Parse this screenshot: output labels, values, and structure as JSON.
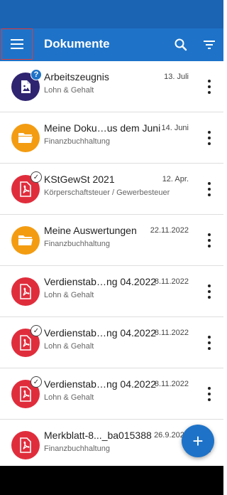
{
  "app": {
    "title": "Dokumente",
    "icons": {
      "menu": "menu-icon",
      "search": "search-icon",
      "filter": "filter-icon",
      "add": "plus-icon"
    },
    "colors": {
      "primary": "#1e73c8",
      "statusbar": "#1b64b3",
      "image_doc": "#2f2470",
      "folder": "#f39c12",
      "pdf": "#e02d3c"
    },
    "fab_label": "+"
  },
  "documents": [
    {
      "title": "Arbeitszeugnis",
      "date": "13. Juli",
      "category": "Lohn & Gehalt",
      "type": "image",
      "badge": "question",
      "badge_text": "?"
    },
    {
      "title": "Meine Doku…us dem Juni",
      "date": "14. Juni",
      "category": "Finanzbuchhaltung",
      "type": "folder",
      "badge": ""
    },
    {
      "title": "KStGewSt 2021",
      "date": "12. Apr.",
      "category": "Körperschaftsteuer / Gewerbesteuer",
      "type": "pdf",
      "badge": "check",
      "badge_text": "✓"
    },
    {
      "title": "Meine Auswertungen",
      "date": "22.11.2022",
      "category": "Finanzbuchhaltung",
      "type": "folder",
      "badge": ""
    },
    {
      "title": "Verdienstab…ng 04.2022",
      "date": "8.11.2022",
      "category": "Lohn & Gehalt",
      "type": "pdf",
      "badge": ""
    },
    {
      "title": "Verdienstab…ng 04.2022",
      "date": "8.11.2022",
      "category": "Lohn & Gehalt",
      "type": "pdf",
      "badge": "check",
      "badge_text": "✓"
    },
    {
      "title": "Verdienstab…ng 04.2022",
      "date": "8.11.2022",
      "category": "Lohn & Gehalt",
      "type": "pdf",
      "badge": "check",
      "badge_text": "✓"
    },
    {
      "title": "Merkblatt-8..._ba015388",
      "date": "26.9.2022",
      "category": "Finanzbuchhaltung",
      "type": "pdf",
      "badge": ""
    }
  ]
}
